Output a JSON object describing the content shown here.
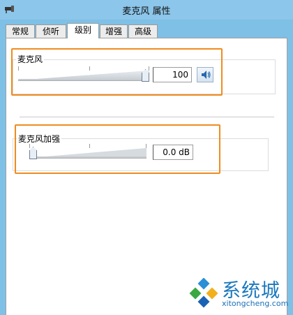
{
  "window": {
    "title": "麦克风 属性"
  },
  "tabs": [
    {
      "label": "常规",
      "active": false
    },
    {
      "label": "侦听",
      "active": false
    },
    {
      "label": "级别",
      "active": true
    },
    {
      "label": "增强",
      "active": false
    },
    {
      "label": "高级",
      "active": false
    }
  ],
  "microphone": {
    "label": "麦克风",
    "value_text": "100",
    "level": 1.0
  },
  "boost": {
    "label": "麦克风加强",
    "value_text": "0.0 dB",
    "level": 0.0
  },
  "icons": {
    "speaker": "speaker-icon",
    "app": "microphone-properties-icon"
  },
  "colors": {
    "highlight": "#f08c1e",
    "accent": "#1a78be"
  },
  "watermark": {
    "brand": "系统城",
    "url": "xitongcheng.com"
  }
}
